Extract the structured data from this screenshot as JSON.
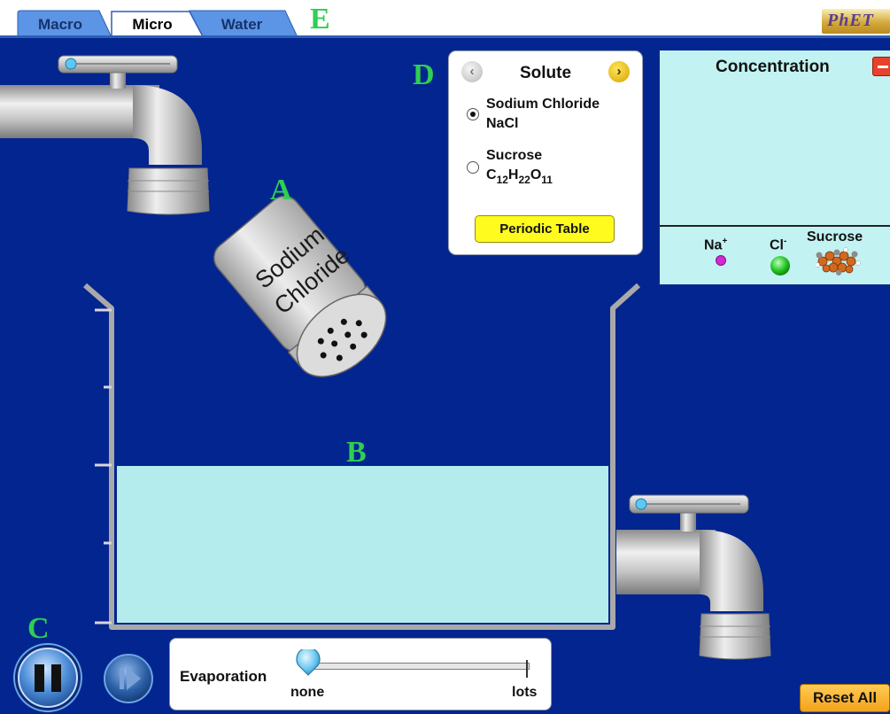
{
  "tabs": [
    {
      "label": "Macro",
      "active": false
    },
    {
      "label": "Micro",
      "active": true
    },
    {
      "label": "Water",
      "active": false
    }
  ],
  "annotations": {
    "a": "A",
    "b": "B",
    "c": "C",
    "d": "D",
    "e": "E"
  },
  "logo": {
    "text": "PhET"
  },
  "shaker": {
    "line1": "Sodium",
    "line2": "Chloride"
  },
  "solute_panel": {
    "title": "Solute",
    "options": [
      {
        "name": "Sodium Chloride",
        "formula": "NaCl",
        "selected": true
      },
      {
        "name": "Sucrose",
        "formula_parts": [
          "C",
          "12",
          "H",
          "22",
          "O",
          "11"
        ],
        "selected": false
      }
    ],
    "periodic_table_label": "Periodic Table"
  },
  "concentration_panel": {
    "title": "Concentration",
    "legend": [
      {
        "label": "Na",
        "charge": "+",
        "color": "#d02ad0"
      },
      {
        "label": "Cl",
        "charge": "-",
        "color": "#2fcf2f"
      },
      {
        "label": "Sucrose",
        "charge": "",
        "color": "#d2691e"
      }
    ]
  },
  "evaporation": {
    "label": "Evaporation",
    "min_label": "none",
    "max_label": "lots",
    "level": 0
  },
  "reset_label": "Reset All",
  "colors": {
    "background": "#03258f",
    "water": "#b4eced",
    "annotation": "#2ecf52"
  }
}
